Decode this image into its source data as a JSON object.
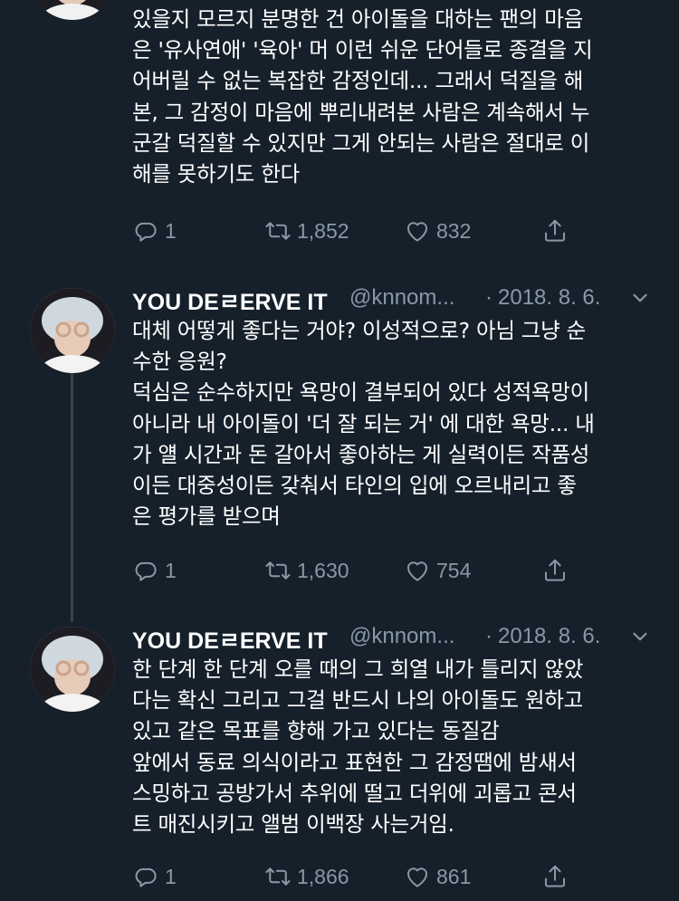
{
  "tweets": [
    {
      "show_header": false,
      "text": "있을지 모르지 분명한 건 아이돌을 대하는 팬의 마음\n은 '유사연애' '육아' 머 이런 쉬운 단어들로 종결을 지\n어버릴 수 없는 복잡한 감정인데... 그래서 덕질을 해\n본, 그 감정이 마음에 뿌리내려본 사람은 계속해서 누\n군갈 덕질할 수 있지만 그게 안되는 사람은 절대로 이\n해를 못하기도 한다",
      "replies": "1",
      "retweets": "1,852",
      "likes": "832"
    },
    {
      "display_name": "YOU DEㄹERVE IT",
      "handle": "@knnom...",
      "separator": "·",
      "date": "2018. 8. 6.",
      "text": "대체 어떻게 좋다는 거야? 이성적으로? 아님 그냥 순\n수한 응원?\n덕심은 순수하지만 욕망이 결부되어 있다 성적욕망이\n아니라 내 아이돌이 '더 잘 되는 거' 에 대한 욕망... 내\n가 얠 시간과 돈 갈아서 좋아하는 게 실력이든 작품성\n이든 대중성이든 갖춰서 타인의 입에 오르내리고 좋\n은 평가를 받으며",
      "replies": "1",
      "retweets": "1,630",
      "likes": "754"
    },
    {
      "display_name": "YOU DEㄹERVE IT",
      "handle": "@knnom...",
      "separator": "·",
      "date": "2018. 8. 6.",
      "text": "한 단계 한 단계 오를 때의 그 희열 내가 틀리지 않았\n다는 확신 그리고 그걸 반드시 나의 아이돌도 원하고\n있고 같은 목표를 향해 가고 있다는 동질감\n앞에서 동료 의식이라고 표현한 그 감정땜에 밤새서\n스밍하고 공방가서 추위에 떨고 더위에 괴롭고 콘서\n트 매진시키고 앨범 이백장 사는거임.",
      "replies": "1",
      "retweets": "1,866",
      "likes": "861"
    }
  ],
  "icons": {
    "reply": "reply-icon",
    "retweet": "retweet-icon",
    "like": "heart-icon",
    "share": "share-icon",
    "caret": "chevron-down-icon"
  },
  "colors": {
    "background": "#15202b",
    "text": "#ffffff",
    "secondary": "#8899a6",
    "thread_line": "#38444d"
  }
}
